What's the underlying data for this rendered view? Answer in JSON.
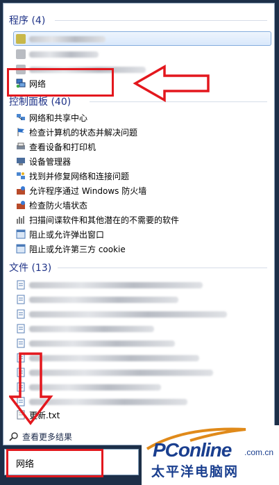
{
  "programs": {
    "header": "程序 (4)",
    "network_item": "网络"
  },
  "control_panel": {
    "header": "控制面板 (40)",
    "items": [
      "网络和共享中心",
      "检查计算机的状态并解决问题",
      "查看设备和打印机",
      "设备管理器",
      "找到并修复网络和连接问题",
      "允许程序通过 Windows 防火墙",
      "检查防火墙状态",
      "扫描间谍软件和其他潜在的不需要的软件",
      "阻止或允许弹出窗口",
      "阻止或允许第三方 cookie"
    ]
  },
  "files": {
    "header": "文件 (13)",
    "last_file": "更新.txt"
  },
  "more_results": "查看更多结果",
  "search": {
    "value": "网络"
  },
  "watermark": {
    "brand": "PConline",
    "sub": ".com.cn",
    "cn": "太平洋电脑网"
  },
  "colors": {
    "annotation_red": "#e3171d",
    "header_blue": "#1e3287",
    "brand_blue": "#1a3f8f"
  }
}
